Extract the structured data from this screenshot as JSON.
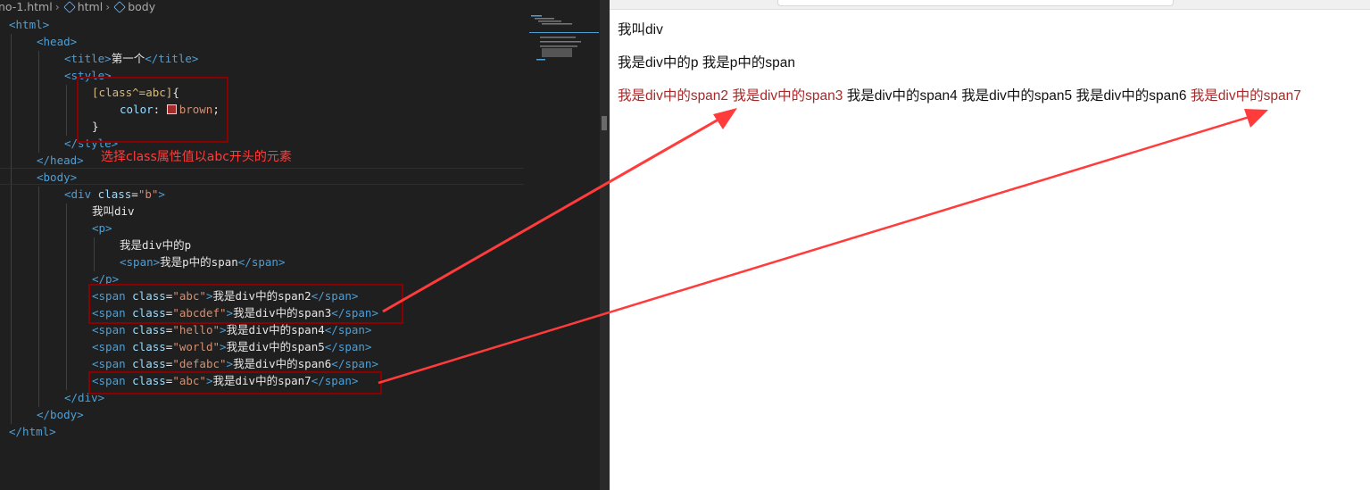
{
  "breadcrumb": {
    "file": "no-1.html",
    "html": "html",
    "body": "body"
  },
  "editor": {
    "lines": [
      [
        [
          "tag",
          "<html>"
        ]
      ],
      [
        [
          "tag",
          "<head>"
        ]
      ],
      [
        [
          "tag",
          "<title>"
        ],
        [
          "txt",
          "第一个"
        ],
        [
          "tag",
          "</title>"
        ]
      ],
      [
        [
          "tag",
          "<style>"
        ]
      ],
      [
        [
          "sel",
          "[class^=abc]"
        ],
        [
          "txt",
          "{"
        ]
      ],
      [
        [
          "prop",
          "color"
        ],
        [
          "txt",
          ": "
        ],
        [
          "swatch",
          ""
        ],
        [
          "val",
          "brown"
        ],
        [
          "txt",
          ";"
        ]
      ],
      [
        [
          "txt",
          "}"
        ]
      ],
      [
        [
          "tag",
          "</style>"
        ]
      ],
      [
        [
          "tag",
          "</head>"
        ]
      ],
      [
        [
          "tag",
          "<body>"
        ]
      ],
      [
        [
          "tag",
          "<div "
        ],
        [
          "attr",
          "class"
        ],
        [
          "txt",
          "="
        ],
        [
          "str",
          "\"b\""
        ],
        [
          "tag",
          ">"
        ]
      ],
      [
        [
          "txt",
          "我叫div"
        ]
      ],
      [
        [
          "tag",
          "<p>"
        ]
      ],
      [
        [
          "txt",
          "我是div中的p"
        ]
      ],
      [
        [
          "tag",
          "<span>"
        ],
        [
          "txt",
          "我是p中的span"
        ],
        [
          "tag",
          "</span>"
        ]
      ],
      [
        [
          "tag",
          "</p>"
        ]
      ],
      [
        [
          "tag",
          "<span "
        ],
        [
          "attr",
          "class"
        ],
        [
          "txt",
          "="
        ],
        [
          "str",
          "\"abc\""
        ],
        [
          "tag",
          ">"
        ],
        [
          "txt",
          "我是div中的span2"
        ],
        [
          "tag",
          "</span>"
        ]
      ],
      [
        [
          "tag",
          "<span "
        ],
        [
          "attr",
          "class"
        ],
        [
          "txt",
          "="
        ],
        [
          "str",
          "\"abcdef\""
        ],
        [
          "tag",
          ">"
        ],
        [
          "txt",
          "我是div中的span3"
        ],
        [
          "tag",
          "</span>"
        ]
      ],
      [
        [
          "tag",
          "<span "
        ],
        [
          "attr",
          "class"
        ],
        [
          "txt",
          "="
        ],
        [
          "str",
          "\"hello\""
        ],
        [
          "tag",
          ">"
        ],
        [
          "txt",
          "我是div中的span4"
        ],
        [
          "tag",
          "</span>"
        ]
      ],
      [
        [
          "tag",
          "<span "
        ],
        [
          "attr",
          "class"
        ],
        [
          "txt",
          "="
        ],
        [
          "str",
          "\"world\""
        ],
        [
          "tag",
          ">"
        ],
        [
          "txt",
          "我是div中的span5"
        ],
        [
          "tag",
          "</span>"
        ]
      ],
      [
        [
          "tag",
          "<span "
        ],
        [
          "attr",
          "class"
        ],
        [
          "txt",
          "="
        ],
        [
          "str",
          "\"defabc\""
        ],
        [
          "tag",
          ">"
        ],
        [
          "txt",
          "我是div中的span6"
        ],
        [
          "tag",
          "</span>"
        ]
      ],
      [
        [
          "tag",
          "<span "
        ],
        [
          "attr",
          "class"
        ],
        [
          "txt",
          "="
        ],
        [
          "str",
          "\"abc\""
        ],
        [
          "tag",
          ">"
        ],
        [
          "txt",
          "我是div中的span7"
        ],
        [
          "tag",
          "</span>"
        ]
      ],
      [
        [
          "tag",
          "</div>"
        ]
      ],
      [
        [
          "tag",
          "</body>"
        ]
      ],
      [
        [
          "tag",
          "</html>"
        ]
      ]
    ],
    "annotation": "选择class属性值以abc开头的元素"
  },
  "browser": {
    "line1": "我叫div",
    "line2": "我是div中的p 我是p中的span",
    "spans": [
      {
        "text": "我是div中的span2",
        "color": "#a52a2a"
      },
      {
        "text": "我是div中的span3",
        "color": "#a52a2a"
      },
      {
        "text": "我是div中的span4",
        "color": "#111111"
      },
      {
        "text": "我是div中的span5",
        "color": "#111111"
      },
      {
        "text": "我是div中的span6",
        "color": "#111111"
      },
      {
        "text": "我是div中的span7",
        "color": "#a52a2a"
      }
    ]
  },
  "colors": {
    "highlight_box": "#8b0000",
    "arrow": "#ff3b3b",
    "brown": "#a52a2a"
  }
}
